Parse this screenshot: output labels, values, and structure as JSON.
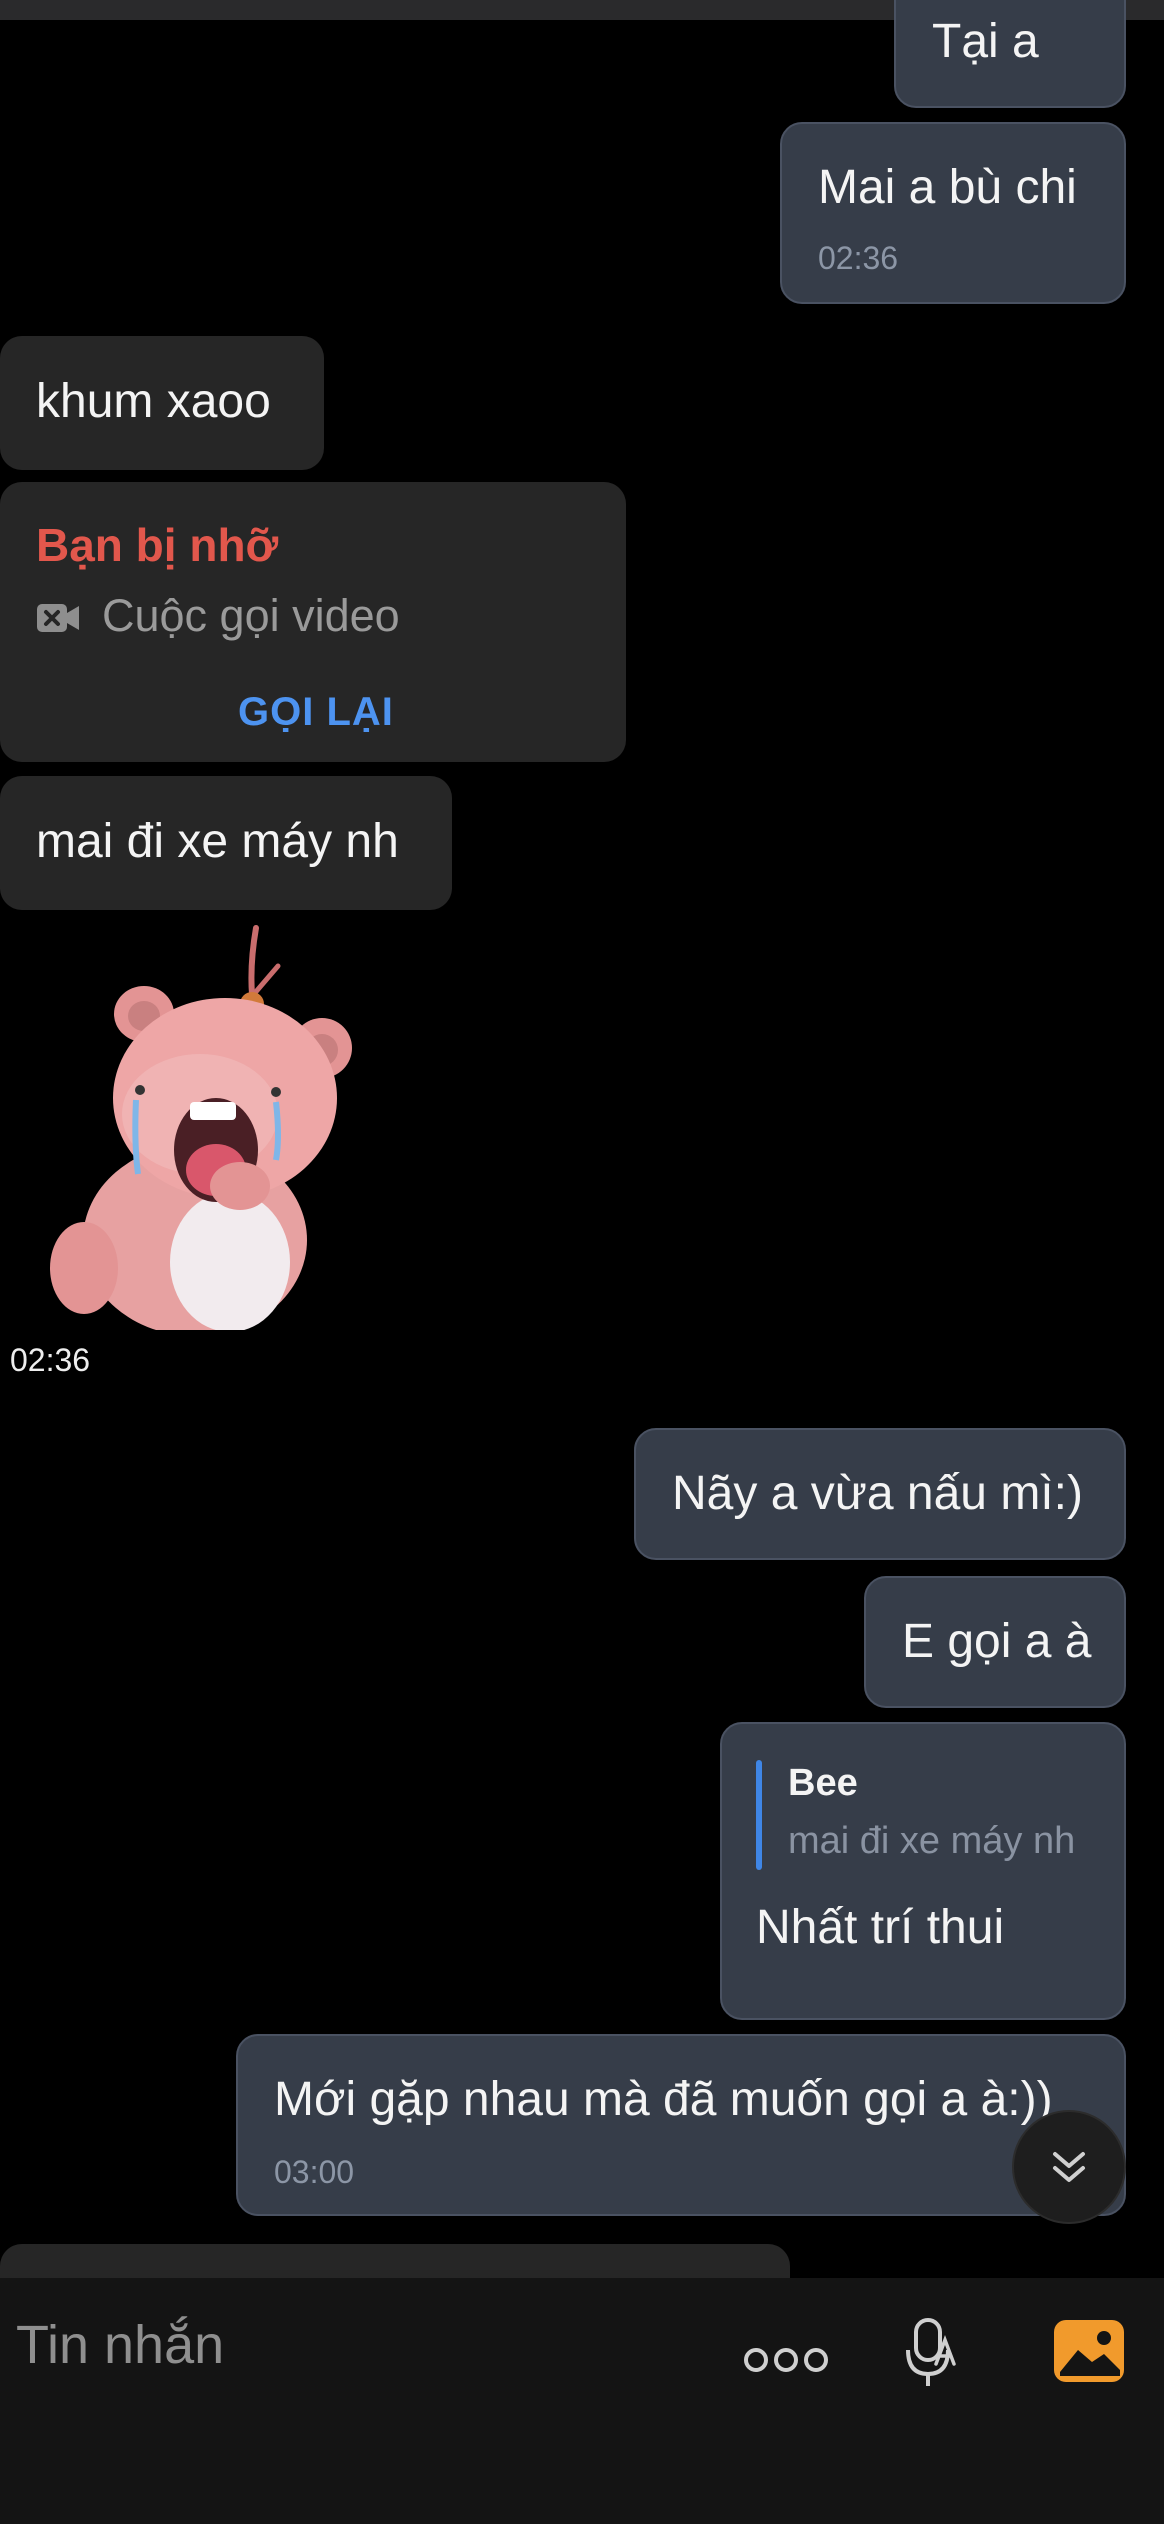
{
  "messages": [
    {
      "text": "Tại a"
    },
    {
      "text": "Mai a bù chi",
      "time": "02:36"
    },
    {
      "text": "khum xaoo"
    },
    {
      "missed_call": {
        "title": "Bạn bị nhỡ",
        "subtitle": "Cuộc gọi video",
        "action": "GỌI LẠI"
      }
    },
    {
      "text": "mai đi xe máy nh"
    },
    {
      "sticker_time": "02:36"
    },
    {
      "text": "Nãy a vừa nấu mì:)"
    },
    {
      "text": "E gọi a à"
    },
    {
      "reply": {
        "name": "Bee",
        "quoted": "mai đi xe máy nh"
      },
      "text": "Nhất trí thui"
    },
    {
      "text": "Mới gặp nhau mà đã muốn gọi a à:))",
      "time": "03:00"
    }
  ],
  "input": {
    "placeholder": "Tin nhắn"
  },
  "icons": {
    "more": "more-dots-icon",
    "voice": "microphone-icon",
    "gallery": "image-icon",
    "scroll": "double-chevron-down-icon",
    "video": "video-camera-missed-icon"
  },
  "colors": {
    "sent_bubble": "#363d49",
    "received_bubble": "#262626",
    "missed_red": "#e2574c",
    "link_blue": "#4d93f0",
    "gallery_orange": "#f19a2c"
  }
}
